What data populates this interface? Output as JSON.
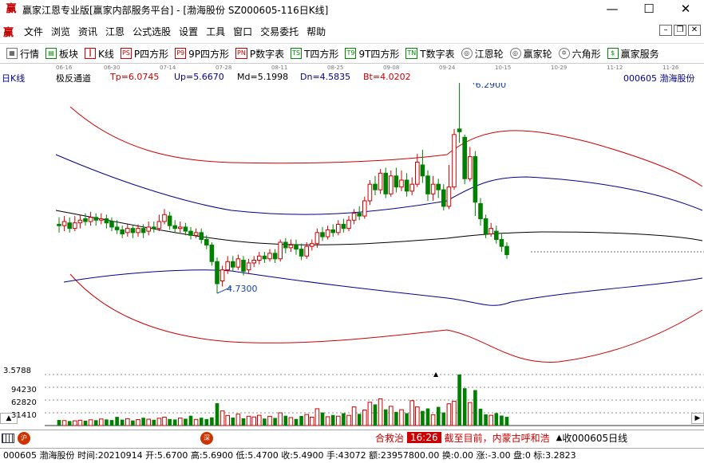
{
  "window": {
    "title": "赢家江恩专业版[赢家内部服务平台] - [渤海股份   SZ000605-116日K线]",
    "app_icon": "赢",
    "minimize": "—",
    "maximize": "☐",
    "close": "✕"
  },
  "menu": {
    "logo": "赢",
    "items": [
      "文件",
      "浏览",
      "资讯",
      "江恩",
      "公式选股",
      "设置",
      "工具",
      "窗口",
      "交易委托",
      "帮助"
    ]
  },
  "toolbar": {
    "items": [
      {
        "icon": "▦",
        "label": "行情"
      },
      {
        "icon": "▤",
        "label": "板块"
      },
      {
        "icon": "┃",
        "label": "K线"
      },
      {
        "icon": "PS",
        "label": "P四方形"
      },
      {
        "icon": "P9",
        "label": "9P四方形"
      },
      {
        "icon": "PN",
        "label": "P数字表"
      },
      {
        "icon": "TS",
        "label": "T四方形"
      },
      {
        "icon": "T9",
        "label": "9T四方形"
      },
      {
        "icon": "TN",
        "label": "T数字表"
      },
      {
        "icon": "◎",
        "label": "江恩轮"
      },
      {
        "icon": "◎",
        "label": "赢家轮"
      },
      {
        "icon": "✡",
        "label": "六角形"
      },
      {
        "icon": "$",
        "label": "赢家服务"
      }
    ]
  },
  "date_axis": [
    "06-16",
    "06-30",
    "07-14",
    "07-28",
    "08-11",
    "08-25",
    "09-08",
    "09-24",
    "10-15",
    "10-29",
    "11-12",
    "11-26"
  ],
  "indicator": {
    "period": "日K线",
    "name": "极反通道",
    "tp": "Tp=6.0745",
    "up": "Up=5.6670",
    "md": "Md=5.1998",
    "dn": "Dn=4.5835",
    "bt": "Bt=4.0202",
    "stock": "000605  渤海股份"
  },
  "price_labels": {
    "high": "6.2900",
    "low": "4.7300"
  },
  "volume_axis": [
    "3.5788",
    "94230",
    "62820",
    "31410"
  ],
  "colors": {
    "up": "#d00000",
    "down": "#008000",
    "outer_band": "#cc0000",
    "inner_band": "#00008b",
    "mid_band": "#000000",
    "label_blue": "#1a3fa0"
  },
  "ticker": {
    "text1": "合救治",
    "time": "16:26",
    "text2": "截至目前，内蒙古呼和浩",
    "arrow": "▲",
    "scroll": "收000605日线"
  },
  "tabs": {
    "badge1": "沪",
    "badge2": "深"
  },
  "status": "000605 渤海股份 时间:20210914 开:5.6700 高:5.6900 低:5.4700 收:5.4900 手:43072 额:23957800.00 换:0.00 涨:-3.00 盘:0 标:3.2823",
  "chart_data": {
    "type": "candlestick",
    "period": "daily",
    "price_labels": {
      "high": 6.29,
      "low": 4.73
    },
    "indicator_values": {
      "Tp": 6.0745,
      "Up": 5.667,
      "Md": 5.1998,
      "Dn": 4.5835,
      "Bt": 4.0202
    },
    "volume_axis": [
      3.5788,
      94230,
      62820,
      31410
    ],
    "candles": [
      [
        5.23,
        5.22,
        5.28,
        5.17
      ],
      [
        5.22,
        5.25,
        5.29,
        5.18
      ],
      [
        5.24,
        5.2,
        5.28,
        5.17
      ],
      [
        5.2,
        5.24,
        5.29,
        5.18
      ],
      [
        5.24,
        5.26,
        5.3,
        5.2
      ],
      [
        5.27,
        5.25,
        5.31,
        5.22
      ],
      [
        5.25,
        5.28,
        5.32,
        5.22
      ],
      [
        5.28,
        5.26,
        5.31,
        5.22
      ],
      [
        5.26,
        5.27,
        5.31,
        5.23
      ],
      [
        5.27,
        5.24,
        5.3,
        5.2
      ],
      [
        5.25,
        5.21,
        5.28,
        5.18
      ],
      [
        5.21,
        5.19,
        5.26,
        5.16
      ],
      [
        5.19,
        5.16,
        5.22,
        5.13
      ],
      [
        5.17,
        5.2,
        5.23,
        5.14
      ],
      [
        5.2,
        5.17,
        5.22,
        5.13
      ],
      [
        5.17,
        5.2,
        5.23,
        5.14
      ],
      [
        5.2,
        5.17,
        5.23,
        5.13
      ],
      [
        5.18,
        5.21,
        5.25,
        5.15
      ],
      [
        5.21,
        5.2,
        5.25,
        5.17
      ],
      [
        5.2,
        5.25,
        5.3,
        5.18
      ],
      [
        5.25,
        5.3,
        5.34,
        5.23
      ],
      [
        5.29,
        5.22,
        5.32,
        5.19
      ],
      [
        5.22,
        5.2,
        5.26,
        5.17
      ],
      [
        5.2,
        5.21,
        5.25,
        5.17
      ],
      [
        5.21,
        5.18,
        5.24,
        5.15
      ],
      [
        5.18,
        5.15,
        5.21,
        5.12
      ],
      [
        5.15,
        5.17,
        5.2,
        5.13
      ],
      [
        5.17,
        5.12,
        5.2,
        5.09
      ],
      [
        5.12,
        5.08,
        5.15,
        5.05
      ],
      [
        5.08,
        4.96,
        5.1,
        4.93
      ],
      [
        4.96,
        4.8,
        4.99,
        4.73
      ],
      [
        4.82,
        4.9,
        4.93,
        4.78
      ],
      [
        4.9,
        4.96,
        5.0,
        4.87
      ],
      [
        4.96,
        4.92,
        5.0,
        4.89
      ],
      [
        4.92,
        4.98,
        5.01,
        4.9
      ],
      [
        4.97,
        4.89,
        5.0,
        4.86
      ],
      [
        4.9,
        4.95,
        4.98,
        4.87
      ],
      [
        4.95,
        4.97,
        5.0,
        4.92
      ],
      [
        4.97,
        5.0,
        5.03,
        4.94
      ],
      [
        5.0,
        4.98,
        5.03,
        4.95
      ],
      [
        4.98,
        5.02,
        5.05,
        4.96
      ],
      [
        5.02,
        4.98,
        5.05,
        4.95
      ],
      [
        4.98,
        5.1,
        5.12,
        4.96
      ],
      [
        5.1,
        5.06,
        5.13,
        5.02
      ],
      [
        5.06,
        5.08,
        5.12,
        5.03
      ],
      [
        5.08,
        5.05,
        5.12,
        5.01
      ],
      [
        5.05,
        5.0,
        5.09,
        4.97
      ],
      [
        5.0,
        5.07,
        5.1,
        4.98
      ],
      [
        5.07,
        5.09,
        5.12,
        5.04
      ],
      [
        5.09,
        5.17,
        5.2,
        5.06
      ],
      [
        5.17,
        5.14,
        5.21,
        5.11
      ],
      [
        5.14,
        5.19,
        5.22,
        5.12
      ],
      [
        5.19,
        5.17,
        5.23,
        5.14
      ],
      [
        5.17,
        5.23,
        5.26,
        5.15
      ],
      [
        5.23,
        5.2,
        5.27,
        5.17
      ],
      [
        5.2,
        5.26,
        5.29,
        5.18
      ],
      [
        5.26,
        5.31,
        5.34,
        5.23
      ],
      [
        5.31,
        5.29,
        5.36,
        5.26
      ],
      [
        5.29,
        5.4,
        5.43,
        5.27
      ],
      [
        5.4,
        5.52,
        5.55,
        5.37
      ],
      [
        5.52,
        5.48,
        5.58,
        5.44
      ],
      [
        5.48,
        5.6,
        5.63,
        5.45
      ],
      [
        5.6,
        5.45,
        5.64,
        5.42
      ],
      [
        5.45,
        5.58,
        5.62,
        5.43
      ],
      [
        5.58,
        5.5,
        5.64,
        5.46
      ],
      [
        5.5,
        5.55,
        5.62,
        5.47
      ],
      [
        5.55,
        5.47,
        5.6,
        5.43
      ],
      [
        5.47,
        5.52,
        5.57,
        5.44
      ],
      [
        5.52,
        5.68,
        5.74,
        5.5
      ],
      [
        5.66,
        5.58,
        5.77,
        5.53
      ],
      [
        5.58,
        5.45,
        5.62,
        5.4
      ],
      [
        5.45,
        5.52,
        5.58,
        5.4
      ],
      [
        5.52,
        5.48,
        5.56,
        5.42
      ],
      [
        5.48,
        5.36,
        5.52,
        5.33
      ],
      [
        5.36,
        5.5,
        5.66,
        5.34
      ],
      [
        5.5,
        5.88,
        5.92,
        5.48
      ],
      [
        5.92,
        5.9,
        6.29,
        5.82
      ],
      [
        5.86,
        5.56,
        5.88,
        5.52
      ],
      [
        5.56,
        5.72,
        5.79,
        5.54
      ],
      [
        5.72,
        5.39,
        5.76,
        5.29
      ],
      [
        5.38,
        5.27,
        5.42,
        5.22
      ],
      [
        5.27,
        5.16,
        5.3,
        5.13
      ],
      [
        5.16,
        5.2,
        5.24,
        5.14
      ],
      [
        5.18,
        5.12,
        5.22,
        5.09
      ],
      [
        5.12,
        5.07,
        5.16,
        5.03
      ],
      [
        5.07,
        5.01,
        5.1,
        4.98
      ]
    ],
    "volume": [
      9000,
      8000,
      7200,
      7600,
      8500,
      7800,
      9200,
      8600,
      10500,
      9800,
      8800,
      14000,
      9500,
      11000,
      8200,
      9600,
      12500,
      10200,
      9300,
      11800,
      13500,
      10500,
      9700,
      12000,
      11000,
      15800,
      9900,
      12600,
      10400,
      13200,
      36000,
      23500,
      16200,
      12800,
      18400,
      11600,
      15000,
      13800,
      16500,
      11200,
      14900,
      12200,
      20500,
      15800,
      12800,
      10600,
      15400,
      17800,
      13400,
      27000,
      21000,
      14200,
      17000,
      15100,
      19800,
      16400,
      30000,
      18800,
      25000,
      37500,
      34000,
      43000,
      26000,
      31000,
      22000,
      25500,
      19800,
      40000,
      30000,
      23500,
      27500,
      17500,
      30000,
      21000,
      35000,
      39000,
      82000,
      60000,
      37000,
      57000,
      27000,
      18000,
      16500,
      20000,
      16000,
      14000
    ]
  }
}
